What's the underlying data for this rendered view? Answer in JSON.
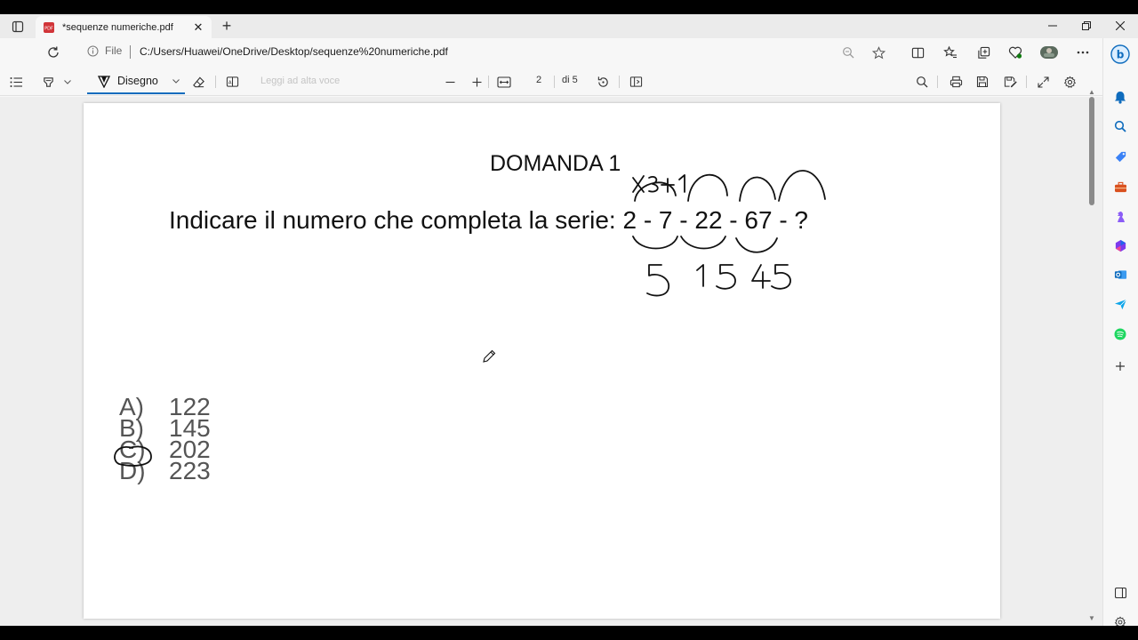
{
  "tab": {
    "title": "*sequenze numeriche.pdf",
    "close": "✕",
    "new_tab": "+"
  },
  "window": {
    "minimize": "─",
    "restore": "❐",
    "close": "✕"
  },
  "address": {
    "scheme_label": "File",
    "url": "C:/Users/Huawei/OneDrive/Desktop/sequenze%20numeriche.pdf"
  },
  "pdf_toolbar": {
    "draw_label": "Disegno",
    "read_aloud": "Leggi ad alta voce",
    "page_current": "2",
    "page_total": "di 5"
  },
  "document": {
    "title": "DOMANDA 1",
    "question": "Indicare il numero che completa la serie: 2 - 7 - 22 - 67 - ?",
    "answers": [
      {
        "letter": "A)",
        "value": "122"
      },
      {
        "letter": "B)",
        "value": "145"
      },
      {
        "letter": "C)",
        "value": "202"
      },
      {
        "letter": "D)",
        "value": "223"
      }
    ],
    "handwriting": {
      "rule": "x3+1",
      "differences": [
        "5",
        "15",
        "45"
      ],
      "circled_answer": "C"
    }
  },
  "colors": {
    "accent": "#0f6cbd",
    "ink": "#111111",
    "page": "#ffffff"
  }
}
